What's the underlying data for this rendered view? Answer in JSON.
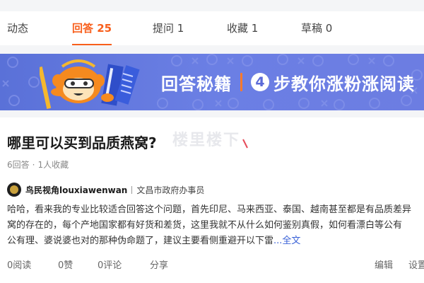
{
  "tabs": [
    {
      "label": "动态",
      "active": false
    },
    {
      "label": "回答 25",
      "active": true
    },
    {
      "label": "提问 1",
      "active": false
    },
    {
      "label": "收藏 1",
      "active": false
    },
    {
      "label": "草稿 0",
      "active": false
    }
  ],
  "banner": {
    "text_part1": "回答秘籍",
    "step_number": "4",
    "text_part2": "步教你涨粉涨阅读"
  },
  "question": {
    "title": "哪里可以买到品质燕窝?",
    "answers_count": "6回答",
    "meta_dot": "·",
    "favorites": "1人收藏"
  },
  "watermark": {
    "text": "楼里楼下"
  },
  "author": {
    "name": "鸟民视角louxiawenwan",
    "title": "文昌市政府办事员"
  },
  "answer": {
    "line1": "哈哈，看来我的专业比较适合回答这个问题，首先印尼、马来西亚、泰国、越南甚至都是有品质差异",
    "line2": "窝的存在的，每个产地国家都有好货和差货，这里我就不从什么如何鉴别真假，如何看漂白等公有",
    "line3": "公有理、婆说婆也对的那种伪命题了，建议主要看侧重避开以下雷",
    "more": "...全文"
  },
  "actions": {
    "reads": "0阅读",
    "likes": "0赞",
    "comments": "0评论",
    "share": "分享",
    "edit": "编辑",
    "settings": "设置"
  },
  "colors": {
    "accent": "#f85f1c",
    "banner": "#6b7fe4",
    "link": "#3a62d7"
  }
}
